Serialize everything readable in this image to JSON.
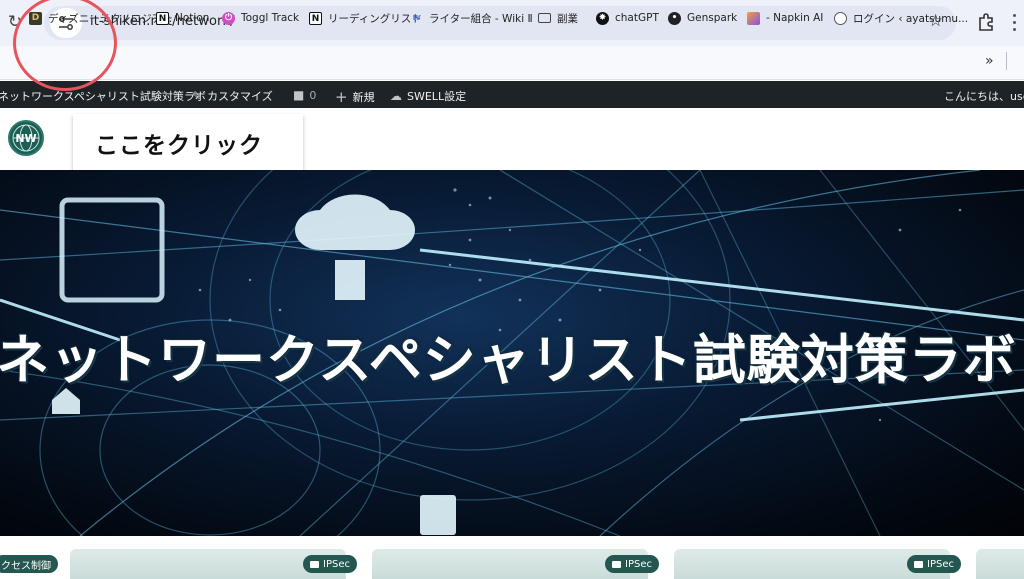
{
  "browser": {
    "url": "it-shiken.net/network/"
  },
  "bookmarks": [
    {
      "label": "ディズニーテクノロジア...",
      "icon": "disney-icon"
    },
    {
      "label": "Notion",
      "icon": "notion-icon"
    },
    {
      "label": "Toggl Track",
      "icon": "toggl-icon"
    },
    {
      "label": "リーディングリスト",
      "icon": "notion-icon"
    },
    {
      "label": "ライター組合 - Wiki Ⅱ",
      "icon": "wiki-icon"
    },
    {
      "label": "副業",
      "icon": "folder-icon"
    },
    {
      "label": "chatGPT",
      "icon": "openai-icon"
    },
    {
      "label": "Genspark",
      "icon": "genspark-icon"
    },
    {
      "label": "- Napkin AI",
      "icon": "napkin-icon"
    },
    {
      "label": "ログイン ‹ ayatsumu...",
      "icon": "login-icon"
    }
  ],
  "adminbar": {
    "site_name": "ネットワークスペシャリスト試験対策ラボ",
    "customize": "カスタマイズ",
    "comments": "0",
    "new": "新規",
    "swell": "SWELL設定",
    "greeting": "こんにちは、use"
  },
  "header": {
    "callout": "ここをクリック",
    "logo_text": "NW"
  },
  "hero": {
    "title": "ネットワークスペシャリスト試験対策ラボ"
  },
  "cards": [
    {
      "tag": "クセス制御"
    },
    {
      "tag": "IPSec"
    },
    {
      "tag": "IPSec"
    },
    {
      "tag": "IPSec"
    }
  ],
  "colors": {
    "annotation": "#e7545c",
    "adminbar": "#1d2327",
    "tag": "#23574f"
  }
}
